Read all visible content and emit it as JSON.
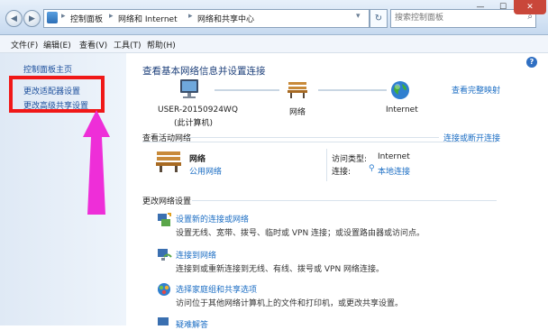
{
  "address": {
    "segments": [
      "控制面板",
      "网络和 Internet",
      "网络和共享中心"
    ]
  },
  "search": {
    "placeholder": "搜索控制面板"
  },
  "window_controls": [
    "—",
    "☐",
    "✕"
  ],
  "menu": [
    "文件(F)",
    "编辑(E)",
    "查看(V)",
    "工具(T)",
    "帮助(H)"
  ],
  "sidebar": {
    "items": [
      "控制面板主页",
      "更改适配器设置",
      "更改高级共享设置"
    ]
  },
  "main": {
    "title": "查看基本网络信息并设置连接",
    "full_map_link": "查看完整映射",
    "computer_name": "USER-20150924WQ",
    "computer_note": "(此计算机)",
    "network_label": "网络",
    "internet_label": "Internet",
    "active_heading": "查看活动网络",
    "connect_link": "连接或断开连接",
    "network_name": "网络",
    "network_type": "公用网络",
    "access_type_label": "访问类型:",
    "access_type_value": "Internet",
    "connection_label": "连接:",
    "connection_value": "本地连接",
    "change_heading": "更改网络设置",
    "tasks": [
      {
        "title": "设置新的连接或网络",
        "desc": "设置无线、宽带、拨号、临时或 VPN 连接；或设置路由器或访问点。"
      },
      {
        "title": "连接到网络",
        "desc": "连接到或重新连接到无线、有线、拨号或 VPN 网络连接。"
      },
      {
        "title": "选择家庭组和共享选项",
        "desc": "访问位于其他网络计算机上的文件和打印机，或更改共享设置。"
      },
      {
        "title": "疑难解答",
        "desc": ""
      }
    ]
  },
  "colors": {
    "link": "#1c6ec4",
    "heading": "#1c3f7a",
    "highlight_box": "#f01818",
    "arrow": "#ee2ed8"
  }
}
